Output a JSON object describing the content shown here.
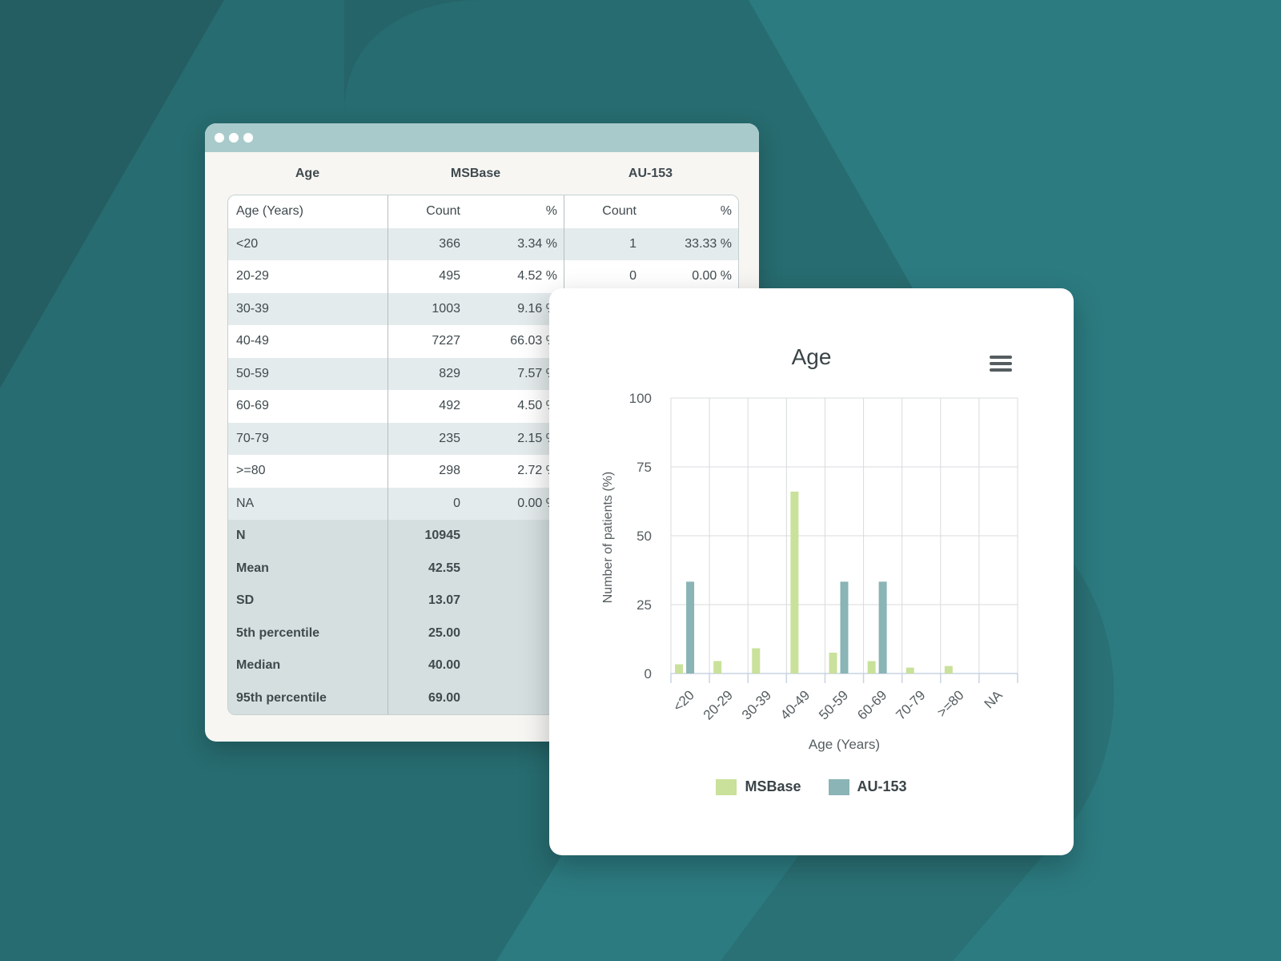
{
  "table": {
    "group_headers": {
      "age": "Age",
      "msbase": "MSBase",
      "au": "AU-153"
    },
    "columns": {
      "label": "Age (Years)",
      "count1": "Count",
      "pct1": "%",
      "count2": "Count",
      "pct2": "%"
    },
    "rows": [
      {
        "label": "<20",
        "count1": "366",
        "pct1": "3.34 %",
        "count2": "1",
        "pct2": "33.33 %"
      },
      {
        "label": "20-29",
        "count1": "495",
        "pct1": "4.52 %",
        "count2": "0",
        "pct2": "0.00 %"
      },
      {
        "label": "30-39",
        "count1": "1003",
        "pct1": "9.16 %",
        "count2": "",
        "pct2": ""
      },
      {
        "label": "40-49",
        "count1": "7227",
        "pct1": "66.03 %",
        "count2": "",
        "pct2": ""
      },
      {
        "label": "50-59",
        "count1": "829",
        "pct1": "7.57 %",
        "count2": "",
        "pct2": ""
      },
      {
        "label": "60-69",
        "count1": "492",
        "pct1": "4.50 %",
        "count2": "",
        "pct2": ""
      },
      {
        "label": "70-79",
        "count1": "235",
        "pct1": "2.15 %",
        "count2": "",
        "pct2": ""
      },
      {
        "label": ">=80",
        "count1": "298",
        "pct1": "2.72 %",
        "count2": "",
        "pct2": ""
      },
      {
        "label": "NA",
        "count1": "0",
        "pct1": "0.00 %",
        "count2": "",
        "pct2": ""
      }
    ],
    "stats": [
      {
        "label": "N",
        "value": "10945"
      },
      {
        "label": "Mean",
        "value": "42.55"
      },
      {
        "label": "SD",
        "value": "13.07"
      },
      {
        "label": "5th percentile",
        "value": "25.00"
      },
      {
        "label": "Median",
        "value": "40.00"
      },
      {
        "label": "95th percentile",
        "value": "69.00"
      }
    ]
  },
  "chart": {
    "title": "Age",
    "menu_icon": "hamburger-menu-icon"
  },
  "chart_data": {
    "type": "bar",
    "title": "Age",
    "xlabel": "Age (Years)",
    "ylabel": "Number of patients (%)",
    "categories": [
      "<20",
      "20-29",
      "30-39",
      "40-49",
      "50-59",
      "60-69",
      "70-79",
      ">=80",
      "NA"
    ],
    "series": [
      {
        "name": "MSBase",
        "color": "#c9e19a",
        "values": [
          3.34,
          4.52,
          9.16,
          66.03,
          7.57,
          4.5,
          2.15,
          2.72,
          0
        ]
      },
      {
        "name": "AU-153",
        "color": "#8ab4b5",
        "values": [
          33.33,
          0,
          0,
          0,
          33.33,
          33.33,
          0,
          0,
          0
        ]
      }
    ],
    "ylim": [
      0,
      100
    ],
    "yticks": [
      0,
      25,
      50,
      75,
      100
    ],
    "grid": true,
    "legend": "bottom"
  },
  "colors": {
    "background": "#2c7b80",
    "titlebar": "#a9cacb",
    "msbase": "#c9e19a",
    "au153": "#8ab4b5"
  }
}
